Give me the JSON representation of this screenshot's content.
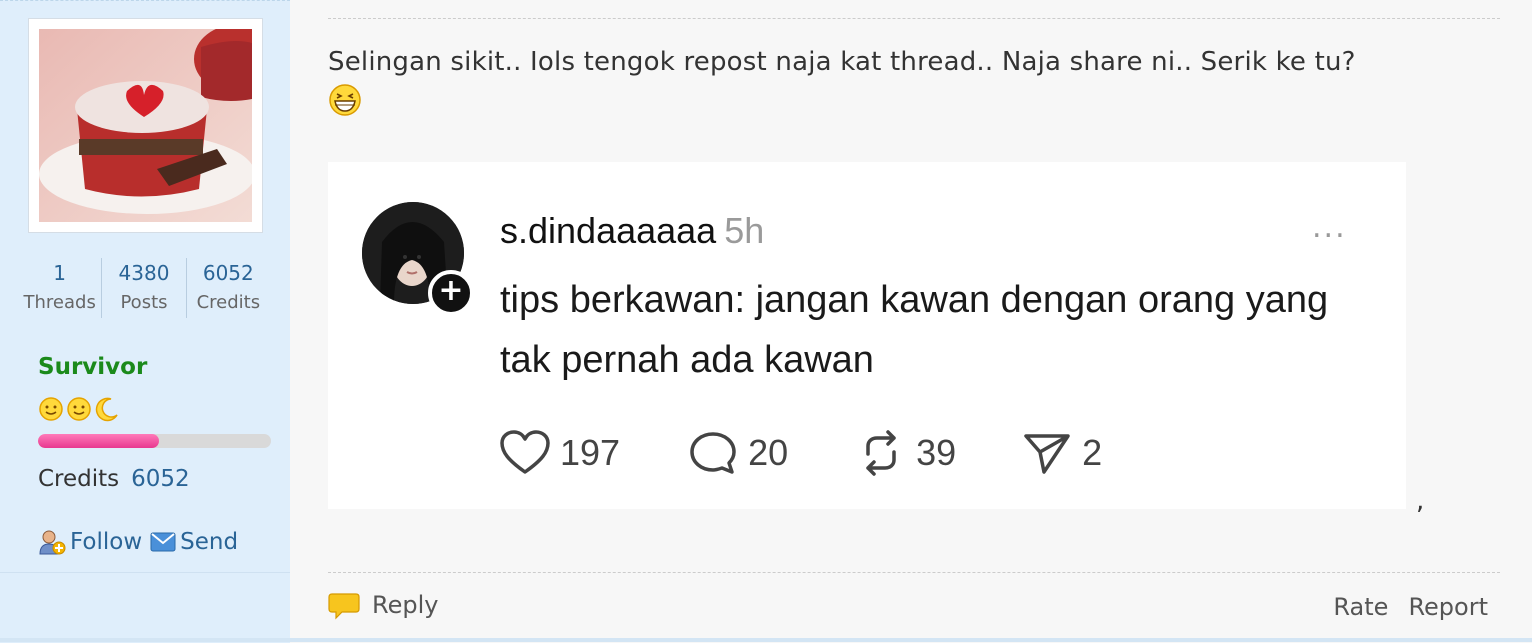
{
  "user": {
    "stats": [
      {
        "value": "1",
        "label": "Threads"
      },
      {
        "value": "4380",
        "label": "Posts"
      },
      {
        "value": "6052",
        "label": "Credits"
      }
    ],
    "rank": "Survivor",
    "rank_progress": 0.52,
    "credits_label": "Credits",
    "credits_value": "6052",
    "follow_label": "Follow",
    "send_label": "Send"
  },
  "post": {
    "text": "Selingan sikit.. Iols tengok repost naja kat thread.. Naja share ni.. Serik ke tu?",
    "embed": {
      "username": "s.dindaaaaaa",
      "time": "5h",
      "more": "...",
      "plus": "+",
      "text": "tips berkawan: jangan kawan dengan orang yang tak pernah ada kawan",
      "likes": "197",
      "comments": "20",
      "reposts": "39",
      "shares": "2"
    },
    "trailing": ","
  },
  "footer": {
    "reply_label": "Reply",
    "rate_label": "Rate",
    "report_label": "Report"
  },
  "colors": {
    "sidebar_bg": "#dfeefb",
    "link": "#2a6496",
    "rank": "#1b8a1b",
    "progress": "#e8388f"
  }
}
